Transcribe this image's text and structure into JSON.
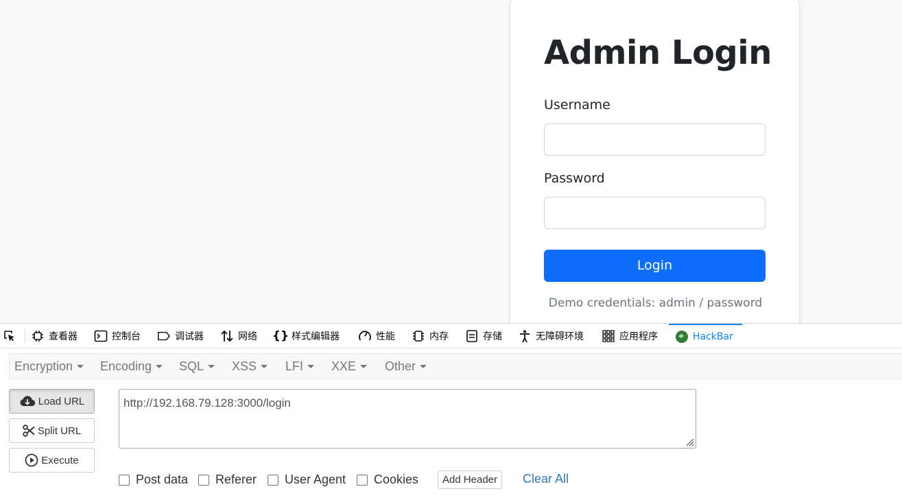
{
  "login": {
    "title": "Admin Login",
    "username_label": "Username",
    "username_value": "",
    "password_label": "Password",
    "password_value": "",
    "button_label": "Login",
    "demo_credentials": "Demo credentials: admin / password"
  },
  "devtools": {
    "tabs": [
      {
        "label": "查看器",
        "icon": "inspector-icon"
      },
      {
        "label": "控制台",
        "icon": "console-icon"
      },
      {
        "label": "调试器",
        "icon": "debugger-icon"
      },
      {
        "label": "网络",
        "icon": "network-icon"
      },
      {
        "label": "样式编辑器",
        "icon": "style-editor-icon"
      },
      {
        "label": "性能",
        "icon": "performance-icon"
      },
      {
        "label": "内存",
        "icon": "memory-icon"
      },
      {
        "label": "存储",
        "icon": "storage-icon"
      },
      {
        "label": "无障碍环境",
        "icon": "accessibility-icon"
      },
      {
        "label": "应用程序",
        "icon": "application-icon"
      },
      {
        "label": "HackBar",
        "icon": "hackbar-icon",
        "active": true
      }
    ],
    "accent_color": "#0a84ff"
  },
  "hackbar": {
    "menu": [
      "Encryption",
      "Encoding",
      "SQL",
      "XSS",
      "LFI",
      "XXE",
      "Other"
    ],
    "buttons": {
      "load_url": "Load URL",
      "split_url": "Split URL",
      "execute": "Execute"
    },
    "url": "http://192.168.79.128:3000/login",
    "options": {
      "post_data": "Post data",
      "referer": "Referer",
      "user_agent": "User Agent",
      "cookies": "Cookies"
    },
    "add_header": "Add Header",
    "clear_all": "Clear All"
  },
  "colors": {
    "primary_button": "#0d6efd",
    "link": "#337ab7"
  }
}
